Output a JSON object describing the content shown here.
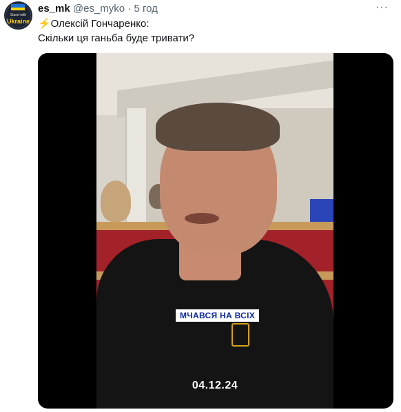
{
  "tweet": {
    "name": "es_mk",
    "handle": "@es_myko",
    "separator": "·",
    "time": "5 год",
    "more_icon": "more-horizontal-icon",
    "lines": [
      "⚡Олексій Гончаренко:",
      "Скільки ця ганьба буде тривати?"
    ]
  },
  "avatar": {
    "small_text": "Stand with",
    "big_text": "Ukraine",
    "colors": {
      "blue": "#1e73d8",
      "yellow": "#ffd500"
    }
  },
  "media": {
    "caption": "МЧАВСЯ НА ВСІХ",
    "date": "04.12.24"
  }
}
